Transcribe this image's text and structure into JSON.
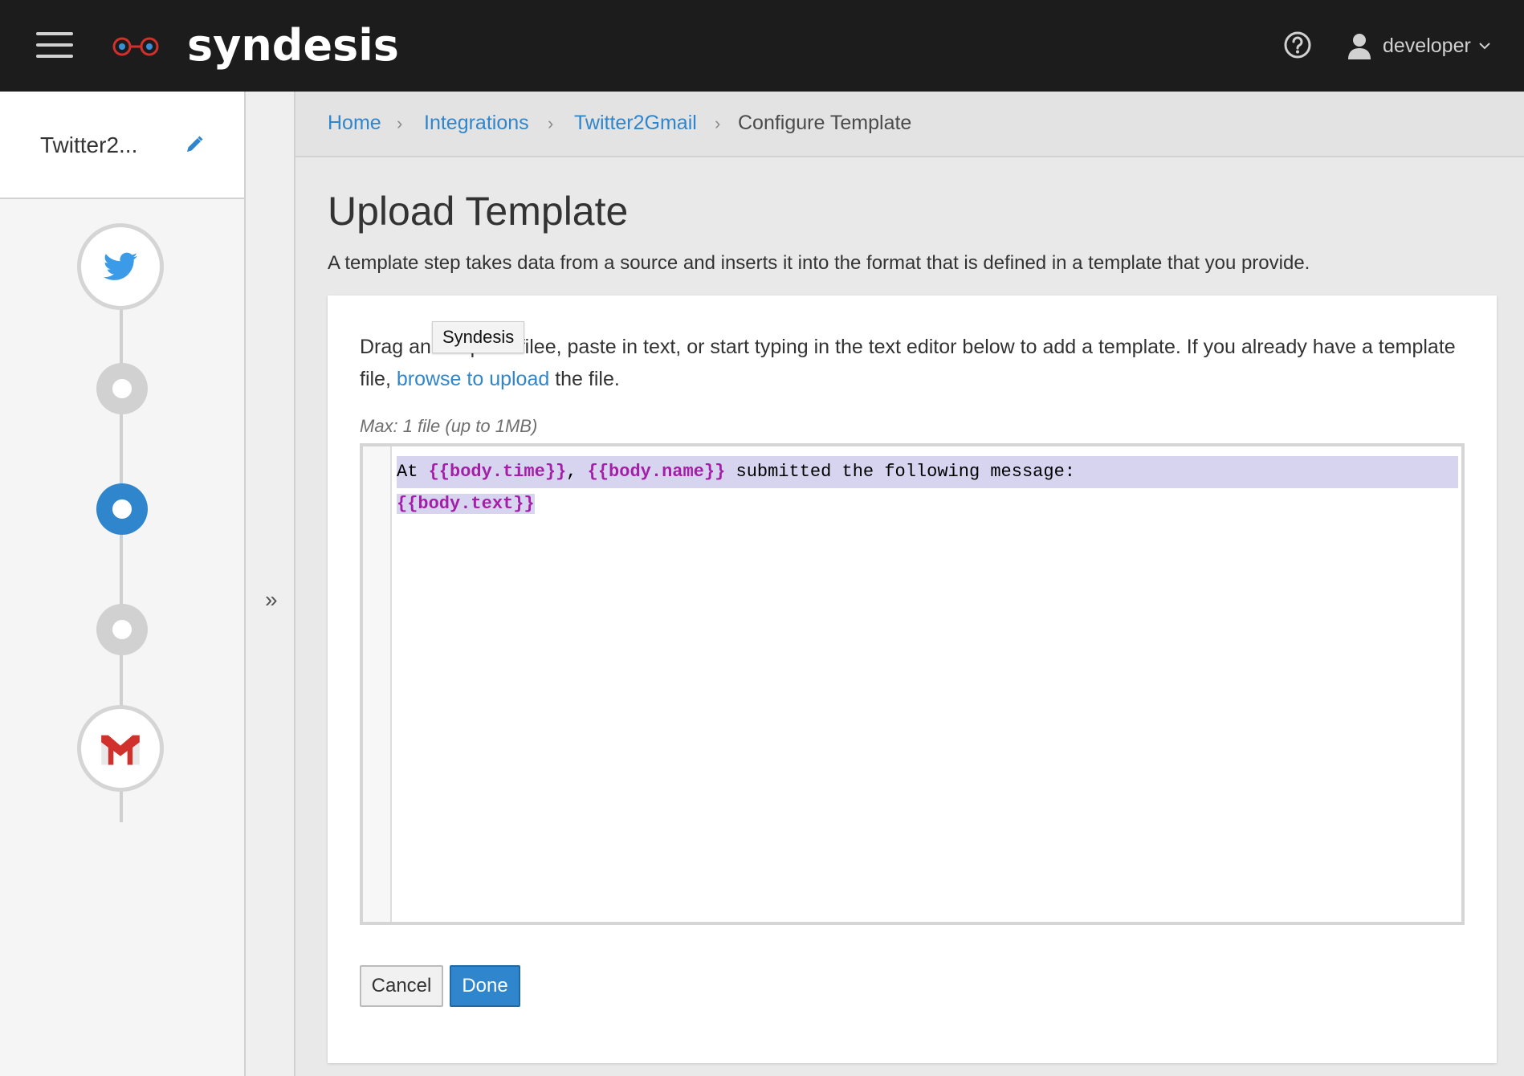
{
  "app": {
    "brand": "syndesis",
    "user": "developer"
  },
  "sidebar": {
    "integration_name": "Twitter2...",
    "steps": [
      {
        "kind": "connection",
        "icon": "twitter-icon",
        "state": "default"
      },
      {
        "kind": "step",
        "icon": "dot",
        "state": "default"
      },
      {
        "kind": "step",
        "icon": "dot",
        "state": "active"
      },
      {
        "kind": "step",
        "icon": "dot",
        "state": "default"
      },
      {
        "kind": "connection",
        "icon": "gmail-icon",
        "state": "default"
      }
    ],
    "collapse_label": "»"
  },
  "breadcrumb": {
    "items": [
      "Home",
      "Integrations",
      "Twitter2Gmail"
    ],
    "current": "Configure Template",
    "separator": "›"
  },
  "page": {
    "title": "Upload Template",
    "description": "A template step takes data from a source and inserts it into the format that is defined in a template that you provide."
  },
  "card": {
    "instructions_before": "Drag an",
    "instructions_hidden": " template file",
    "instructions_middle": "e, paste in text, or start typing in the text editor below to add a template. If you already have a template file, ",
    "upload_link": "browse to upload",
    "instructions_after": " the file.",
    "tooltip": "Syndesis",
    "max_hint": "Max: 1 file (up to 1MB)"
  },
  "editor": {
    "line1": {
      "t1": "At ",
      "t2": "{{body.time}}",
      "t3": ", ",
      "t4": "{{body.name}}",
      "t5": " submitted the following message:"
    },
    "line2": "{{body.text}}"
  },
  "buttons": {
    "cancel": "Cancel",
    "done": "Done"
  },
  "colors": {
    "navbar_bg": "#1c1c1c",
    "link": "#2f86cc",
    "primary": "#2f86cc",
    "template_token": "#a31fa8",
    "selection": "#d7d4f0"
  }
}
